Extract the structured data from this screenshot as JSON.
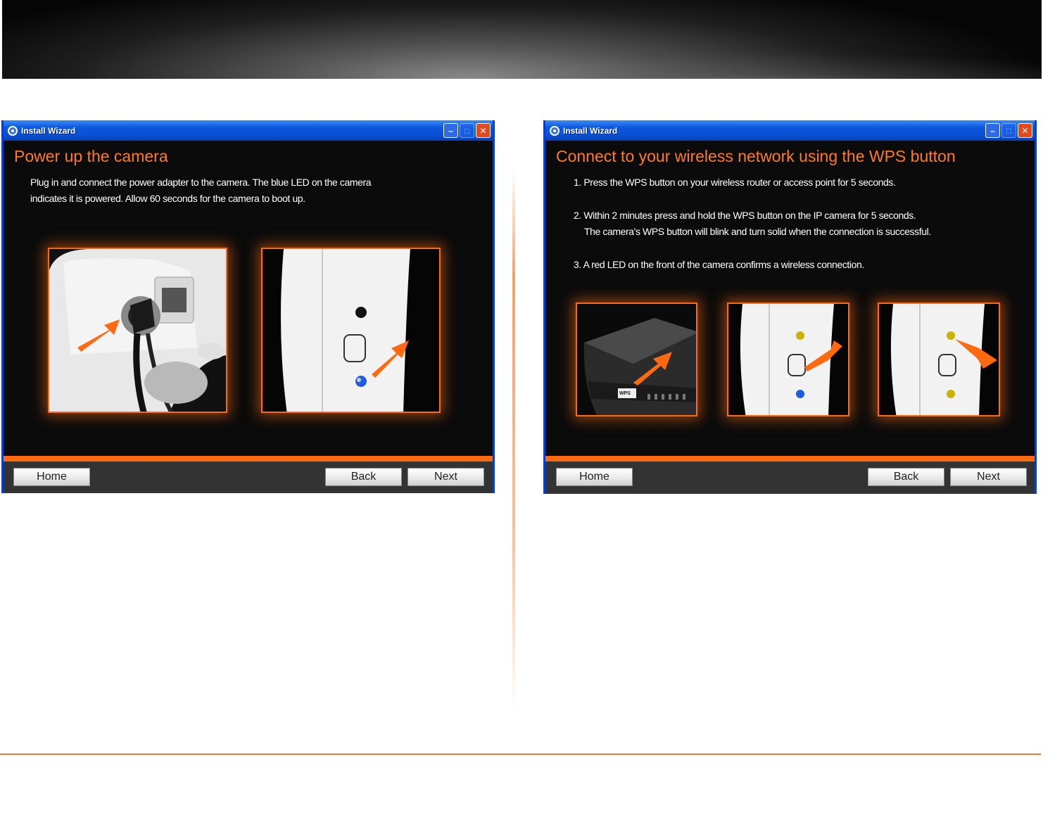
{
  "left_wizard": {
    "window_title": "Install Wizard",
    "heading": "Power up the camera",
    "body_line1": "Plug in and connect the power adapter to the camera. The blue LED on the camera",
    "body_line2": "indicates it is powered. Allow 60 seconds for the camera to boot up.",
    "home_label": "Home",
    "back_label": "Back",
    "next_label": "Next"
  },
  "right_wizard": {
    "window_title": "Install Wizard",
    "heading": "Connect to your wireless network using the WPS button",
    "step1": "1. Press the WPS button on your wireless router or access point for 5 seconds.",
    "step2_line1": "2. Within 2 minutes press and hold the WPS button on the IP camera for 5 seconds.",
    "step2_line2": "The camera's WPS button will blink and turn solid when the connection is successful.",
    "step3": "3. A red LED on the front of the camera confirms a wireless connection.",
    "router_button_label": "WPS",
    "home_label": "Home",
    "back_label": "Back",
    "next_label": "Next"
  },
  "colors": {
    "accent": "#ff7a22",
    "titlebar": "#0b58e0",
    "panel_bg": "#0b0b0b",
    "footer_bg": "#333333",
    "divider": "#e87a3a"
  }
}
